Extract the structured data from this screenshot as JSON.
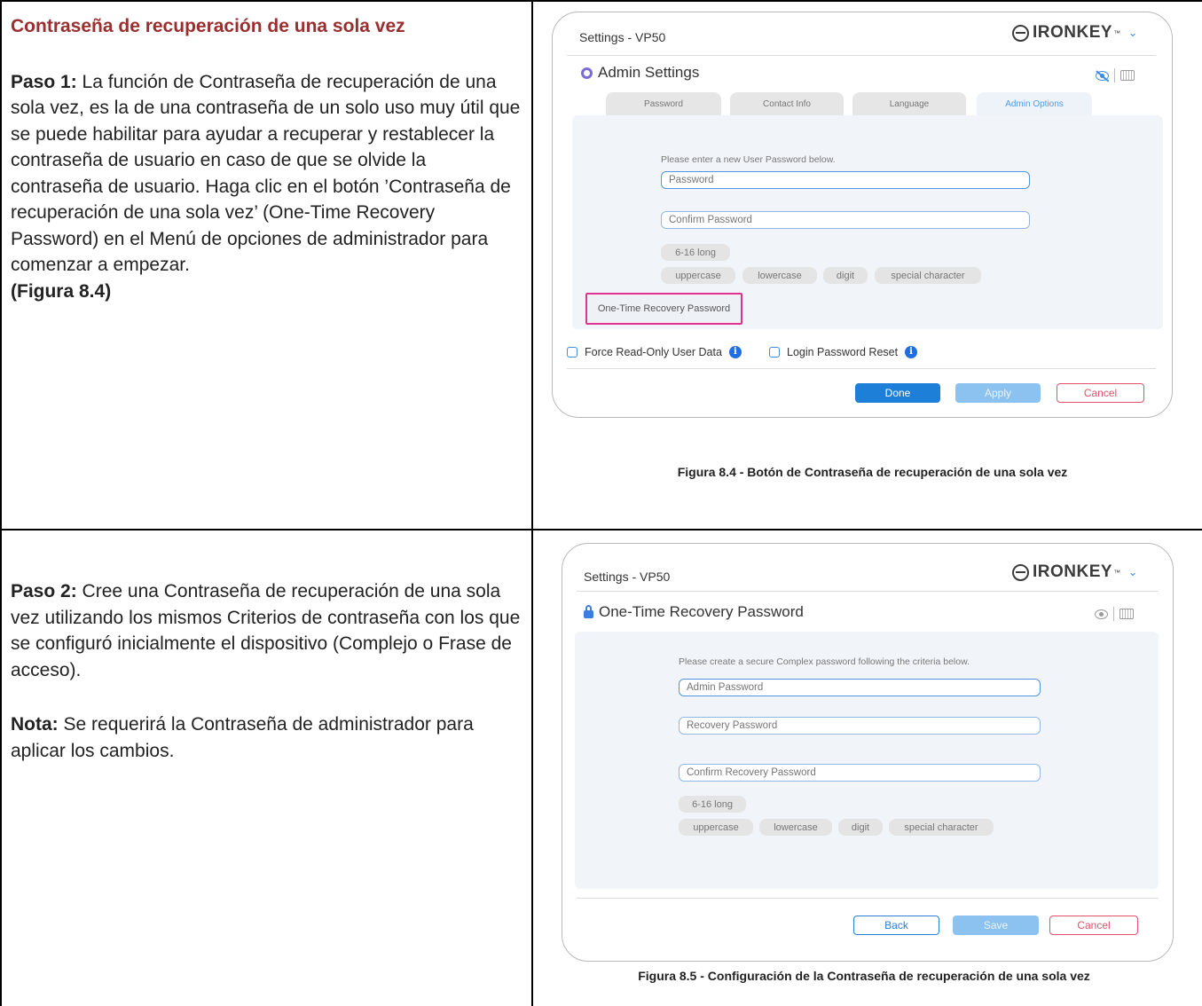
{
  "row1": {
    "title": "Contraseña de recuperación de una sola vez",
    "step_label": "Paso 1:",
    "step_text": " La función de Contraseña de recuperación de una sola vez, es la de una contraseña de un solo uso muy útil que se puede habilitar para ayudar a recuperar y restablecer la contraseña de usuario en caso de que se olvide la contraseña de usuario. Haga clic en el botón ’Contraseña de recuperación de una sola vez’ (One-Time Recovery Password) en el Menú de opciones de administrador para comenzar a empezar.",
    "figure_ref": "(Figura 8.4)",
    "caption": "Figura 8.4 - Botón de Contraseña de recuperación de una sola vez"
  },
  "row2": {
    "step_label": "Paso 2:",
    "step_text": " Cree una Contraseña de recuperación de una sola vez utilizando los mismos Criterios de contraseña con los que se configuró inicialmente el dispositivo (Complejo o Frase de acceso).",
    "note_label": "Nota:",
    "note_text": " Se requerirá la Contraseña de administrador para aplicar los cambios.",
    "caption": "Figura 8.5 - Configuración de la Contraseña de recuperación de una sola vez"
  },
  "window1": {
    "title": "Settings - VP50",
    "brand": "IRONKEY",
    "brand_tm": "™",
    "heading": "Admin Settings",
    "tabs": [
      "Password",
      "Contact Info",
      "Language",
      "Admin Options"
    ],
    "active_tab": "Admin Options",
    "hint": "Please enter a new User Password below.",
    "password_placeholder": "Password",
    "confirm_placeholder": "Confirm Password",
    "chips_length": "6-16 long",
    "chips": [
      "uppercase",
      "lowercase",
      "digit",
      "special character"
    ],
    "otr_button": "One-Time Recovery Password",
    "checkbox1": "Force Read-Only User Data",
    "checkbox2": "Login Password Reset",
    "buttons": {
      "done": "Done",
      "apply": "Apply",
      "cancel": "Cancel"
    },
    "icons": [
      "gear-icon",
      "eye-off-icon",
      "keyboard-icon",
      "info-icon",
      "chevron-down-icon"
    ],
    "accent_color": "#1d7fd8",
    "highlight_color": "#e0338f"
  },
  "window2": {
    "title": "Settings - VP50",
    "brand": "IRONKEY",
    "brand_tm": "™",
    "heading": "One-Time Recovery Password",
    "hint": "Please create a secure Complex password following the criteria below.",
    "admin_placeholder": "Admin Password",
    "recovery_placeholder": "Recovery Password",
    "confirm_placeholder": "Confirm Recovery Password",
    "chips_length": "6-16 long",
    "chips": [
      "uppercase",
      "lowercase",
      "digit",
      "special character"
    ],
    "buttons": {
      "back": "Back",
      "save": "Save",
      "cancel": "Cancel"
    },
    "icons": [
      "lock-icon",
      "eye-icon",
      "keyboard-icon",
      "chevron-down-icon"
    ]
  }
}
